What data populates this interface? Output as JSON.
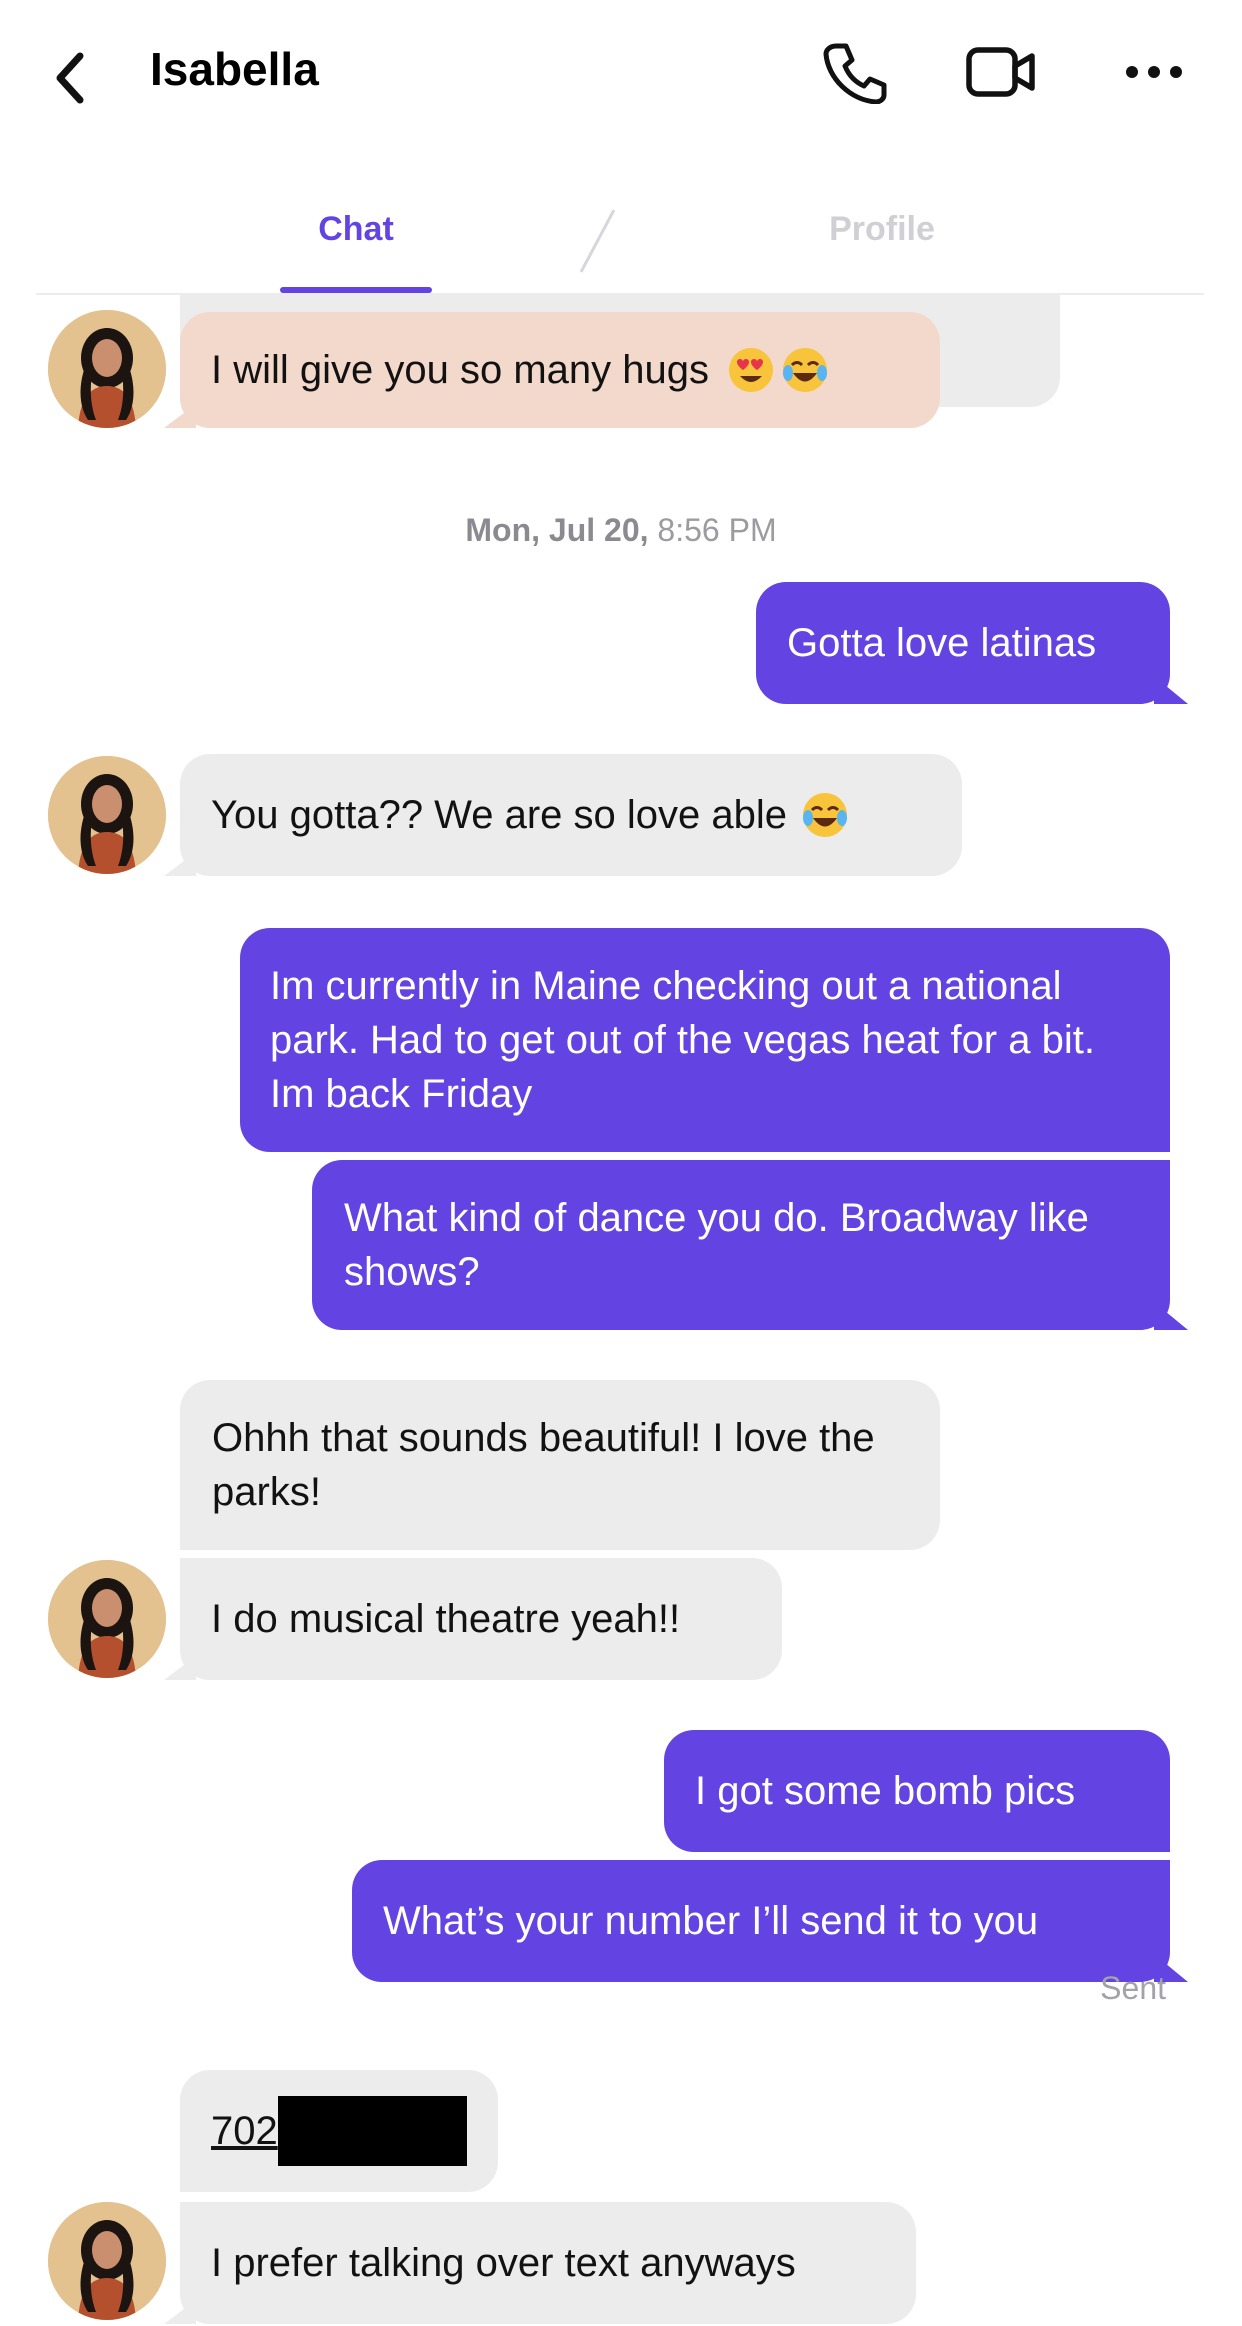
{
  "header": {
    "contact_name": "Isabella",
    "icons": [
      "back-icon",
      "phone-icon",
      "video-icon",
      "more-icon"
    ]
  },
  "tabs": [
    {
      "label": "Chat",
      "active": true
    },
    {
      "label": "Profile",
      "active": false
    }
  ],
  "timestamp": {
    "day": "Mon, Jul 20,",
    "time": "8:56 PM"
  },
  "messages": [
    {
      "from": "them",
      "text": "I will give you so many hugs",
      "emoji": [
        "heart-eyes-emoji",
        "tears-of-joy-emoji"
      ]
    },
    {
      "from": "me",
      "text": "Gotta love latinas"
    },
    {
      "from": "them",
      "text": "You gotta?? We are so love able",
      "emoji": [
        "tears-of-joy-emoji"
      ]
    },
    {
      "from": "me",
      "text": "Im currently in Maine checking out a national park.  Had to get out of the vegas heat for a bit. Im back Friday"
    },
    {
      "from": "me",
      "text": "What kind of dance you do.  Broadway like shows?"
    },
    {
      "from": "them",
      "text": "Ohhh that sounds beautiful! I love the parks!"
    },
    {
      "from": "them",
      "text": "I do musical theatre yeah!!"
    },
    {
      "from": "me",
      "text": "I got some bomb pics"
    },
    {
      "from": "me",
      "text": "What’s your number I’ll send it to you"
    },
    {
      "from": "them",
      "text": "702",
      "redacted": true
    },
    {
      "from": "them",
      "text": "I prefer talking over text anyways"
    }
  ],
  "status": {
    "sent_label": "Sent"
  },
  "colors": {
    "accent": "#6344e2",
    "incoming_bubble": "#ececec",
    "highlight_bubble": "#f3d9cc"
  }
}
